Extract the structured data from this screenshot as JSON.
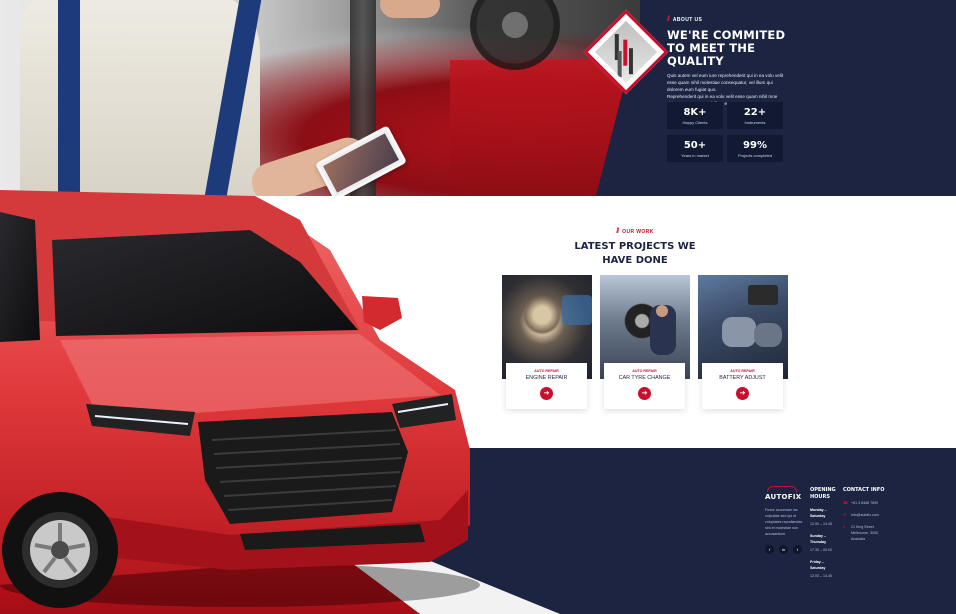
{
  "about": {
    "eyebrow": "ABOUT US",
    "title": "WE'RE COMMITED TO MEET THE QUALITY",
    "paragraph1": "Quis autem vel eum iure reprehenderit qui in ea volu velit esse quam nihil molestiae consequatur, vel illum qui dolorem eum fugiat quo.",
    "paragraph2": "Reprehenderit qui in ea volu velit esse quam nihil moe citiae consequatur, vel illum eu.",
    "stats": [
      {
        "value": "8K+",
        "label": "Happy Clients"
      },
      {
        "value": "22+",
        "label": "Instruments"
      },
      {
        "value": "50+",
        "label": "Years in market"
      },
      {
        "value": "99%",
        "label": "Projects completed"
      }
    ]
  },
  "projects": {
    "eyebrow": "OUR WORK",
    "title_line1": "LATEST PROJECTS WE",
    "title_line2": "HAVE DONE",
    "items": [
      {
        "category": "AUTO REPAIR",
        "title": "ENGINE REPAIR",
        "arrow": "➔"
      },
      {
        "category": "AUTO REPAIR",
        "title": "CAR TYRE CHANGE",
        "arrow": "➔"
      },
      {
        "category": "AUTO REPAIR",
        "title": "BATTERY ADJUST",
        "arrow": "➔"
      }
    ]
  },
  "footer": {
    "brand": "AUTOFIX",
    "description": "Fusce accumsan lac vulputate sed qui et voluptates repudiandae sint et molestiae non accusantium.",
    "social": [
      "f",
      "in",
      "t"
    ],
    "hours_heading": "OPENING HOURS",
    "hours": [
      {
        "day": "Monday – Saturday",
        "time": "12.00 – 14.45"
      },
      {
        "day": "Sunday – Thursday",
        "time": "17.30 – 00.00"
      },
      {
        "day": "Friday – Saturday",
        "time": "12.00 – 14.45"
      }
    ],
    "contact_heading": "CONTACT INFO",
    "contact": {
      "phone": "+61 3 8488 7890",
      "email": "info@autofix.com",
      "address": "21 King Street Melbourne, 3000, Australia"
    }
  },
  "colors": {
    "navy": "#1c2442",
    "red": "#c8102e",
    "white": "#ffffff"
  }
}
